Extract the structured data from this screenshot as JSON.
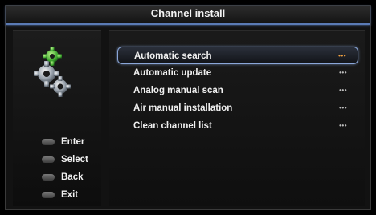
{
  "header": {
    "title": "Channel install"
  },
  "menu": {
    "items": [
      {
        "label": "Automatic search",
        "more": "•••",
        "selected": true
      },
      {
        "label": "Automatic update",
        "more": "•••",
        "selected": false
      },
      {
        "label": "Analog manual scan",
        "more": "•••",
        "selected": false
      },
      {
        "label": "Air manual installation",
        "more": "•••",
        "selected": false
      },
      {
        "label": "Clean channel list",
        "more": "•••",
        "selected": false
      }
    ]
  },
  "keys": [
    {
      "label": "Enter",
      "icon": "ok-button-icon"
    },
    {
      "label": "Select",
      "icon": "nav-button-icon"
    },
    {
      "label": "Back",
      "icon": "menu-button-icon"
    },
    {
      "label": "Exit",
      "icon": "exit-button-icon"
    }
  ],
  "icon": {
    "name": "settings-gears-icon"
  },
  "colors": {
    "accent": "#5a7ab5",
    "highlight": "#8aa6d8",
    "selected_dots": "#f0a040"
  }
}
